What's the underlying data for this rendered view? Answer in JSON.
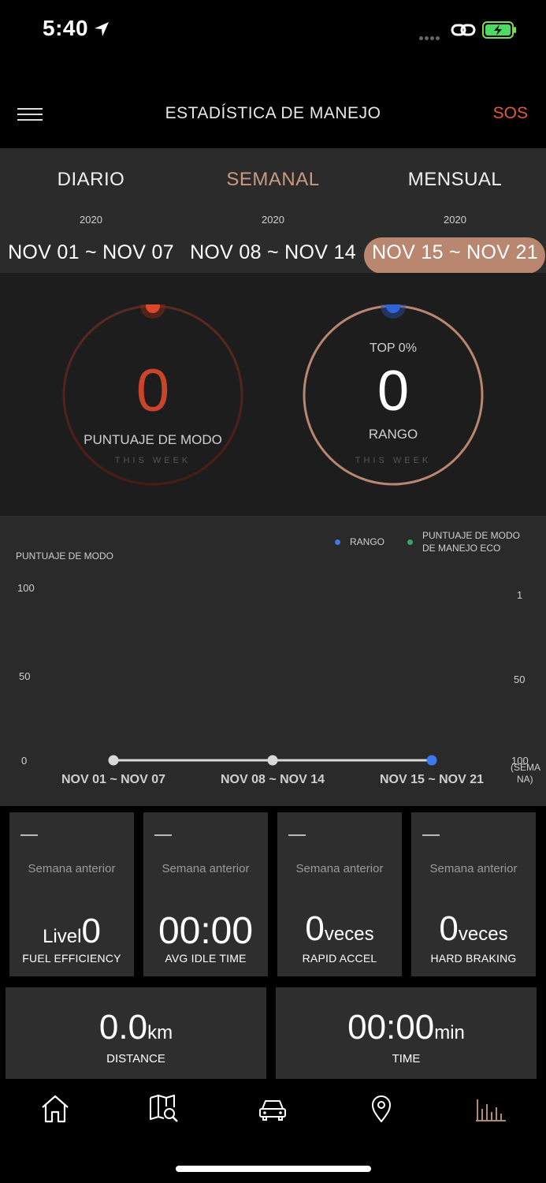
{
  "status_bar": {
    "time": "5:40"
  },
  "header": {
    "title": "ESTADÍSTICA DE MANEJO",
    "sos_label": "SOS"
  },
  "tabs": [
    {
      "label": "DIARIO",
      "year": "2020",
      "range": "NOV 01 ~ NOV 07"
    },
    {
      "label": "SEMANAL",
      "year": "2020",
      "range": "NOV 08 ~ NOV 14"
    },
    {
      "label": "MENSUAL",
      "year": "2020",
      "range": "NOV 15 ~ NOV 21"
    }
  ],
  "active_tab": "SEMANAL",
  "selected_range": "NOV 15 ~ NOV 21",
  "gauges": {
    "mode_score": {
      "value": "0",
      "label": "PUNTUAJE DE MODO",
      "caption": "THIS WEEK",
      "color": "#c8442a"
    },
    "rank": {
      "top": "TOP 0%",
      "value": "0",
      "label": "RANGO",
      "caption": "THIS WEEK",
      "color": "#2f64d8"
    }
  },
  "chart": {
    "legend": [
      {
        "label": "RANGO",
        "color": "#3d78f0"
      },
      {
        "label_line1": "PUNTUAJE DE MODO",
        "label_line2": "DE MANEJO ECO",
        "color": "#3aa56a"
      }
    ],
    "ylabel_left": "PUNTUAJE DE MODO",
    "left_ticks": [
      "100",
      "50",
      "0"
    ],
    "right_ticks": [
      "1",
      "50",
      "100"
    ],
    "right_unit_line1": "(SEMA",
    "right_unit_line2": "NA)"
  },
  "chart_data": {
    "type": "line",
    "categories": [
      "NOV 01 ~ NOV 07",
      "NOV 08 ~ NOV 14",
      "NOV 15 ~ NOV 21"
    ],
    "series": [
      {
        "name": "PUNTUAJE DE MODO DE MANEJO ECO",
        "values": [
          0,
          0,
          0
        ]
      }
    ],
    "selected_index": 2,
    "ylabel": "PUNTUAJE DE MODO",
    "ylim": [
      0,
      100
    ],
    "y2lim": [
      1,
      100
    ]
  },
  "stats": [
    {
      "dash": "—",
      "sub": "Semana anterior",
      "prefix": "Livel",
      "value": "0",
      "suffix": "",
      "label": "FUEL EFFICIENCY"
    },
    {
      "dash": "—",
      "sub": "Semana anterior",
      "prefix": "",
      "value": "00:00",
      "suffix": "",
      "label": "AVG IDLE TIME"
    },
    {
      "dash": "—",
      "sub": "Semana anterior",
      "prefix": "",
      "value": "0",
      "suffix": "veces",
      "label": "RAPID ACCEL"
    },
    {
      "dash": "—",
      "sub": "Semana anterior",
      "prefix": "",
      "value": "0",
      "suffix": "veces",
      "label": "HARD BRAKING"
    }
  ],
  "totals": [
    {
      "value": "0.0",
      "unit": "km",
      "label": "DISTANCE"
    },
    {
      "value": "00:00",
      "unit": "min",
      "label": "TIME"
    }
  ],
  "bottom_nav": [
    {
      "icon": "home-icon"
    },
    {
      "icon": "map-search-icon"
    },
    {
      "icon": "car-icon"
    },
    {
      "icon": "location-pin-icon"
    },
    {
      "icon": "statistics-icon",
      "active": true
    }
  ],
  "colors": {
    "accent": "#c99a80",
    "sos": "#e05a3c",
    "pill": "#b98670"
  }
}
